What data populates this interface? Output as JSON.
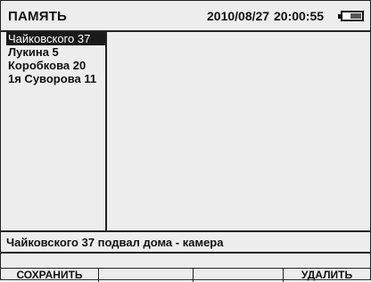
{
  "header": {
    "title": "ПАМЯТЬ",
    "date": "2010/08/27",
    "time": "20:00:55",
    "battery_icon": "battery-icon"
  },
  "list": {
    "items": [
      "Чайковского 37",
      "Лукина 5",
      "Коробкова 20",
      "1я Суворова 11"
    ],
    "selected_index": 0
  },
  "info_bar": {
    "text": "Чайковского 37 подвал дома -  камера"
  },
  "softkeys": {
    "save": "СОХРАНИТЬ",
    "key2": "",
    "key3": "",
    "delete": "УДАЛИТЬ"
  }
}
